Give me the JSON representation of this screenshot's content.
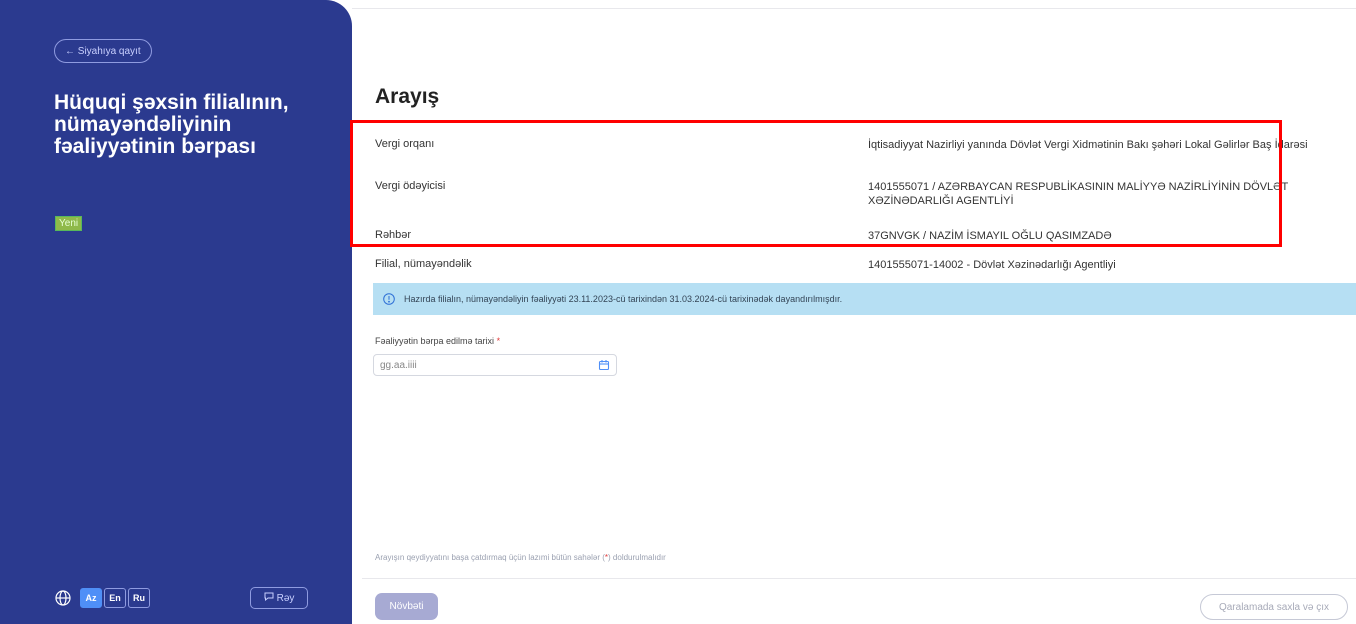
{
  "sidebar": {
    "back_label": "← Siyahıya qayıt",
    "title": "Hüquqi şəxsin filialının, nümayəndəliyinin fəaliyyətinin bərpası",
    "status_badge": "Yeni",
    "languages": [
      "Az",
      "En",
      "Ru"
    ],
    "active_language": "Az",
    "feedback_label": "Rəy",
    "globe_icon": "globe-icon",
    "comment_icon": "comment-icon"
  },
  "main": {
    "title": "Arayış",
    "info": [
      {
        "label": "Vergi orqanı",
        "value": "İqtisadiyyat Nazirliyi yanında Dövlət Vergi Xidmətinin Bakı şəhəri Lokal Gəlirlər Baş İdarəsi"
      },
      {
        "label": "Vergi ödəyicisi",
        "value": "1401555071 / AZƏRBAYCAN RESPUBLİKASININ MALİYYƏ NAZİRLİYİNİN DÖVLƏT XƏZİNƏDARLIĞI AGENTLİYİ"
      },
      {
        "label": "Rəhbər",
        "value": "37GNVGK / NAZİM İSMAYIL OĞLU QASIMZADƏ"
      },
      {
        "label": "Filial, nümayəndəlik",
        "value": "1401555071-14002 - Dövlət Xəzinədarlığı Agentliyi"
      }
    ],
    "notice": "Hazırda filialın, nümayəndəliyin fəaliyyəti 23.11.2023-cü tarixindən 31.03.2024-cü tarixinədək dayandırılmışdır.",
    "date_field": {
      "label": "Fəaliyyətin bərpa edilmə tarixi",
      "required_mark": "*",
      "placeholder": "gg.aa.iiii",
      "value": ""
    },
    "footnote_before": "Arayışın qeydiyyatını başa çatdırmaq üçün lazımi bütün sahələr (",
    "footnote_mark": "*",
    "footnote_after": ") doldurulmalıdır",
    "next_label": "Növbəti",
    "save_exit_label": "Qaralamada saxla və çıx"
  },
  "colors": {
    "sidebar_bg": "#2b3a8f",
    "notice_bg": "#b6dff3",
    "highlight": "#ff0000",
    "active_lang": "#4f8ff7"
  }
}
